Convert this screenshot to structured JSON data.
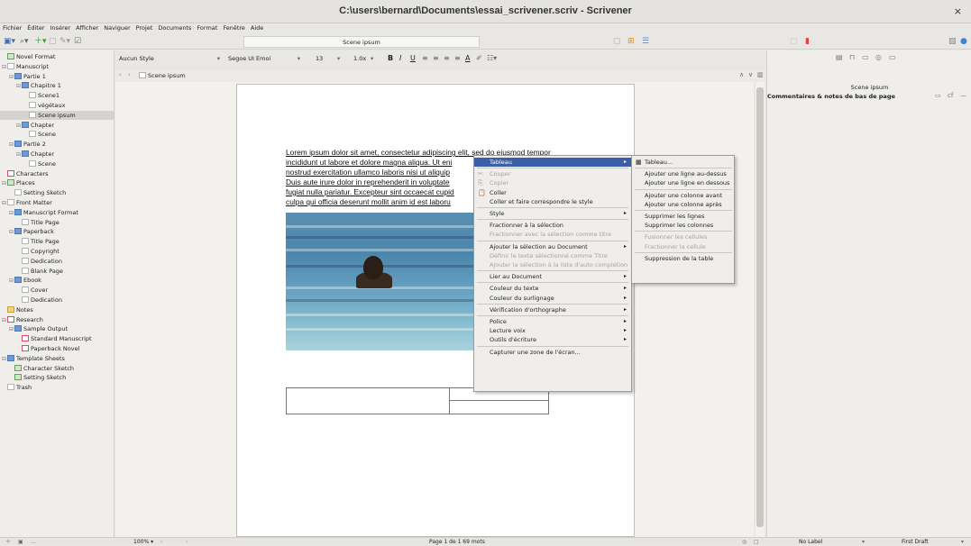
{
  "window": {
    "title": "C:\\users\\bernard\\Documents\\essai_scrivener.scriv - Scrivener",
    "close": "×"
  },
  "menu": [
    "Fichier",
    "Éditer",
    "Insérer",
    "Afficher",
    "Naviguer",
    "Projet",
    "Documents",
    "Format",
    "Fenêtre",
    "Aide"
  ],
  "toolbar": {
    "doc_title": "Scene ipsum"
  },
  "binder": [
    {
      "label": "Novel Format",
      "indent": 0,
      "icon": "ico grn",
      "tog": ""
    },
    {
      "label": "Manuscript",
      "indent": 0,
      "icon": "ico doc",
      "tog": "⊟"
    },
    {
      "label": "Partie 1",
      "indent": 1,
      "icon": "ico fold",
      "tog": "⊟"
    },
    {
      "label": "Chapitre 1",
      "indent": 2,
      "icon": "ico fold",
      "tog": "⊟"
    },
    {
      "label": "Scene1",
      "indent": 3,
      "icon": "ico doc",
      "tog": ""
    },
    {
      "label": "végétaux",
      "indent": 3,
      "icon": "ico doc",
      "tog": ""
    },
    {
      "label": "Scene ipsum",
      "indent": 3,
      "icon": "ico doc",
      "tog": "",
      "sel": true
    },
    {
      "label": "Chapter",
      "indent": 2,
      "icon": "ico fold",
      "tog": "⊟"
    },
    {
      "label": "Scene",
      "indent": 3,
      "icon": "ico doc",
      "tog": ""
    },
    {
      "label": "Partie 2",
      "indent": 1,
      "icon": "ico fold",
      "tog": "⊟"
    },
    {
      "label": "Chapter",
      "indent": 2,
      "icon": "ico fold",
      "tog": "⊟"
    },
    {
      "label": "Scene",
      "indent": 3,
      "icon": "ico doc",
      "tog": ""
    },
    {
      "label": "Characters",
      "indent": 0,
      "icon": "ico red",
      "tog": ""
    },
    {
      "label": "Places",
      "indent": 0,
      "icon": "ico grn",
      "tog": "⊟"
    },
    {
      "label": "Setting Sketch",
      "indent": 1,
      "icon": "ico doc",
      "tog": ""
    },
    {
      "label": "Front Matter",
      "indent": 0,
      "icon": "ico doc",
      "tog": "⊟"
    },
    {
      "label": "Manuscript Format",
      "indent": 1,
      "icon": "ico fold",
      "tog": "⊟"
    },
    {
      "label": "Title Page",
      "indent": 2,
      "icon": "ico doc",
      "tog": ""
    },
    {
      "label": "Paperback",
      "indent": 1,
      "icon": "ico fold",
      "tog": "⊟"
    },
    {
      "label": "Title Page",
      "indent": 2,
      "icon": "ico doc",
      "tog": ""
    },
    {
      "label": "Copyright",
      "indent": 2,
      "icon": "ico doc",
      "tog": ""
    },
    {
      "label": "Dedication",
      "indent": 2,
      "icon": "ico doc",
      "tog": ""
    },
    {
      "label": "Blank Page",
      "indent": 2,
      "icon": "ico doc",
      "tog": ""
    },
    {
      "label": "Ebook",
      "indent": 1,
      "icon": "ico fold",
      "tog": "⊟"
    },
    {
      "label": "Cover",
      "indent": 2,
      "icon": "ico doc",
      "tog": ""
    },
    {
      "label": "Dedication",
      "indent": 2,
      "icon": "ico doc",
      "tog": ""
    },
    {
      "label": "Notes",
      "indent": 0,
      "icon": "ico yel",
      "tog": ""
    },
    {
      "label": "Research",
      "indent": 0,
      "icon": "ico red",
      "tog": "⊟"
    },
    {
      "label": "Sample Output",
      "indent": 1,
      "icon": "ico fold",
      "tog": "⊟"
    },
    {
      "label": "Standard Manuscript",
      "indent": 2,
      "icon": "ico red",
      "tog": ""
    },
    {
      "label": "Paperback Novel",
      "indent": 2,
      "icon": "ico red",
      "tog": ""
    },
    {
      "label": "Template Sheets",
      "indent": 0,
      "icon": "ico fold",
      "tog": "⊟"
    },
    {
      "label": "Character Sketch",
      "indent": 1,
      "icon": "ico grn",
      "tog": ""
    },
    {
      "label": "Setting Sketch",
      "indent": 1,
      "icon": "ico grn",
      "tog": ""
    },
    {
      "label": "Trash",
      "indent": 0,
      "icon": "ico doc",
      "tog": ""
    }
  ],
  "format": {
    "style": "Aucun Style",
    "font": "Segoe UI Emoi",
    "size": "13",
    "spacing": "1.0x"
  },
  "nav": {
    "doc": "Scene ipsum"
  },
  "body": [
    "Lorem ipsum dolor sit amet, consectetur adipiscing elit, sed do eiusmod tempor",
    "incididunt ut labore et dolore magna aliqua. Ut eni",
    "nostrud exercitation ullamco laboris nisi ut aliquip",
    "Duis aute irure dolor in reprehenderit in voluptate",
    "fugiat nulla pariatur. Excepteur sint occaecat cupid",
    "culpa qui officia deserunt mollit anim id est laboru"
  ],
  "inspector": {
    "title": "Scene ipsum",
    "section": "Commentaires & notes de bas de page"
  },
  "status": {
    "zoom": "100%",
    "page": "Page 1 de 1  69 mots",
    "label": "No Label",
    "draft": "First Draft"
  },
  "context_menu": [
    {
      "label": "Tableau",
      "hl": true,
      "sub": true
    },
    {
      "sep": true
    },
    {
      "label": "Couper",
      "dis": true,
      "icon": "✂"
    },
    {
      "label": "Copier",
      "dis": true,
      "icon": "⎘"
    },
    {
      "label": "Coller",
      "icon": "📋"
    },
    {
      "label": "Coller et faire correspondre le style"
    },
    {
      "sep": true
    },
    {
      "label": "Style",
      "sub": true
    },
    {
      "sep": true
    },
    {
      "label": "Fractionner à la sélection"
    },
    {
      "label": "Fractionner avec la sélection comme titre",
      "dis": true
    },
    {
      "sep": true
    },
    {
      "label": "Ajouter la sélection au Document",
      "sub": true
    },
    {
      "label": "Définir le texte sélectionné comme Titre",
      "dis": true
    },
    {
      "label": "Ajouter la sélection à la liste d'auto complétion",
      "dis": true
    },
    {
      "sep": true
    },
    {
      "label": "Lier au Document",
      "sub": true
    },
    {
      "sep": true
    },
    {
      "label": "Couleur du texte",
      "sub": true
    },
    {
      "label": "Couleur du surlignage",
      "sub": true
    },
    {
      "sep": true
    },
    {
      "label": "Vérification d'orthographe",
      "sub": true
    },
    {
      "sep": true
    },
    {
      "label": "Police",
      "sub": true
    },
    {
      "label": "Lecture voix",
      "sub": true
    },
    {
      "label": "Outils d'écriture",
      "sub": true
    },
    {
      "sep": true
    },
    {
      "label": "Capturer une zone de l'écran..."
    }
  ],
  "table_submenu": [
    {
      "label": "Tableau...",
      "icon": "▦"
    },
    {
      "sep": true
    },
    {
      "label": "Ajouter une ligne au-dessus"
    },
    {
      "label": "Ajouter une ligne en dessous"
    },
    {
      "sep": true
    },
    {
      "label": "Ajouter une colonne avant"
    },
    {
      "label": "Ajouter une colonne après"
    },
    {
      "sep": true
    },
    {
      "label": "Supprimer les lignes"
    },
    {
      "label": "Supprimer les colonnes"
    },
    {
      "sep": true
    },
    {
      "label": "Fusionner les cellules",
      "dis": true
    },
    {
      "label": "Fractionner la cellule",
      "dis": true
    },
    {
      "sep": true
    },
    {
      "label": "Suppression de la table"
    }
  ]
}
